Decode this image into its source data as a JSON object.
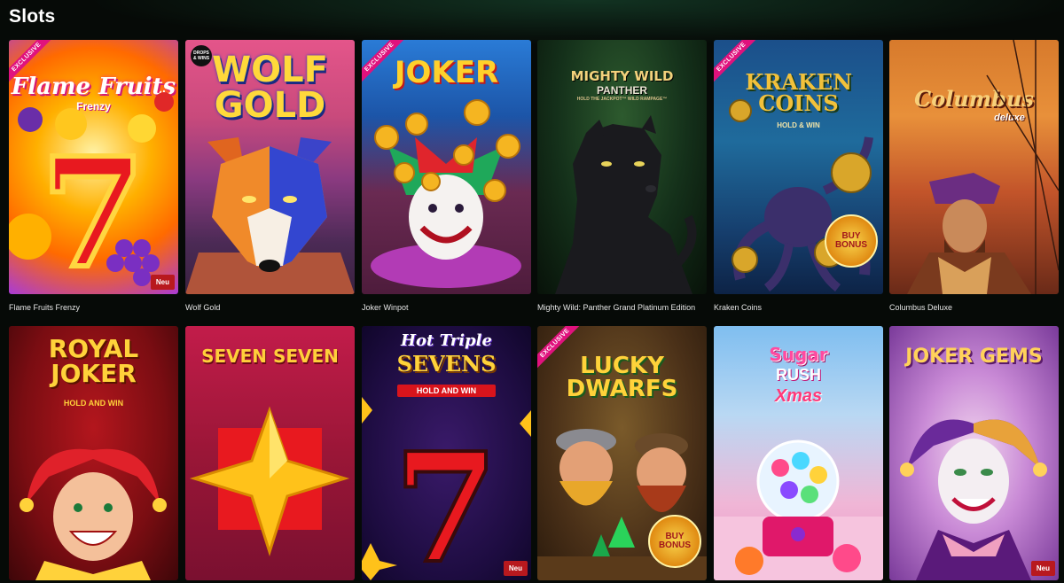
{
  "header": {
    "title": "Slots"
  },
  "labels": {
    "exclusive": "EXCLUSIVE",
    "new": "Neu"
  },
  "games": [
    {
      "name": "Flame Fruits Frenzy",
      "logo": "Flame Fruits",
      "logo_sub": "Frenzy",
      "exclusive": true,
      "new": true,
      "icon": "seven-fruits-art"
    },
    {
      "name": "Wolf Gold",
      "logo": "WOLF GOLD",
      "provider_badge": "DROPS & WINS",
      "icon": "wolf-art"
    },
    {
      "name": "Joker Winpot",
      "logo": "JOKER",
      "exclusive": true,
      "icon": "joker-coins-art"
    },
    {
      "name": "Mighty Wild: Panther Grand Platinum Edition",
      "logo": "MIGHTY WILD",
      "logo_sub": "PANTHER",
      "logo_sub2": "HOLD THE JACKPOT™ WILD RAMPAGE™",
      "icon": "panther-art"
    },
    {
      "name": "Kraken Coins",
      "logo": "KRAKEN COINS",
      "logo_sub": "HOLD & WIN",
      "exclusive": true,
      "bonus": "BUY BONUS",
      "icon": "kraken-art"
    },
    {
      "name": "Columbus Deluxe",
      "logo": "Columbus",
      "logo_sub": "deluxe",
      "icon": "columbus-art"
    },
    {
      "name": "Royal Joker",
      "logo": "ROYAL JOKER",
      "logo_sub": "HOLD AND WIN",
      "icon": "royal-joker-art"
    },
    {
      "name": "Seven Seven",
      "logo": "SEVEN SEVEN",
      "icon": "star-art"
    },
    {
      "name": "Hot Triple Sevens",
      "logo": "Hot Triple",
      "logo_sub": "SEVENS",
      "logo_sub2": "HOLD AND WIN",
      "new": true,
      "icon": "seven-art"
    },
    {
      "name": "Lucky Dwarfs",
      "logo": "LUCKY DWARFS",
      "exclusive": true,
      "bonus": "BUY BONUS",
      "icon": "dwarfs-art"
    },
    {
      "name": "Sugar Rush Xmas",
      "logo": "Sugar",
      "logo_sub": "RUSH",
      "logo_sub2": "Xmas",
      "icon": "candy-machine-art"
    },
    {
      "name": "Joker Gems",
      "logo": "JOKER GEMS",
      "new": true,
      "icon": "joker-gems-art"
    }
  ]
}
